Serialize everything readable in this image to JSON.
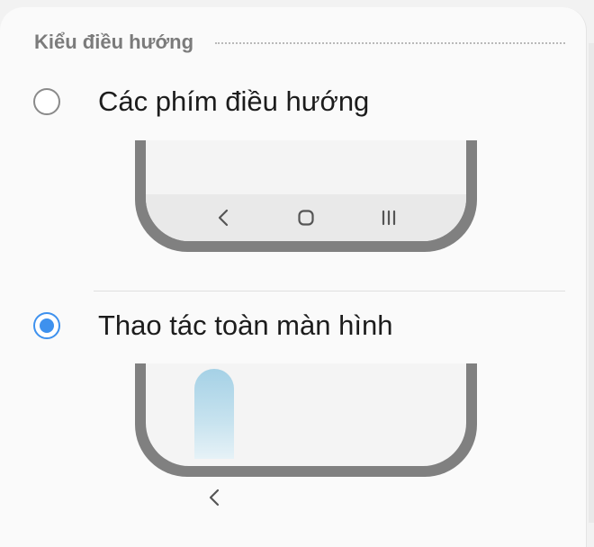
{
  "section": {
    "title": "Kiểu điều hướng"
  },
  "options": [
    {
      "label": "Các phím điều hướng",
      "selected": false,
      "navbar_icons": [
        "back-icon",
        "home-icon",
        "recents-icon"
      ]
    },
    {
      "label": "Thao tác toàn màn hình",
      "selected": true,
      "gesture_hint": "back-icon"
    }
  ],
  "colors": {
    "accent": "#3e91ee",
    "phone_frame": "#808080",
    "navbar": "#e9e9e9",
    "gesture_pill": "#a5d1e6"
  }
}
